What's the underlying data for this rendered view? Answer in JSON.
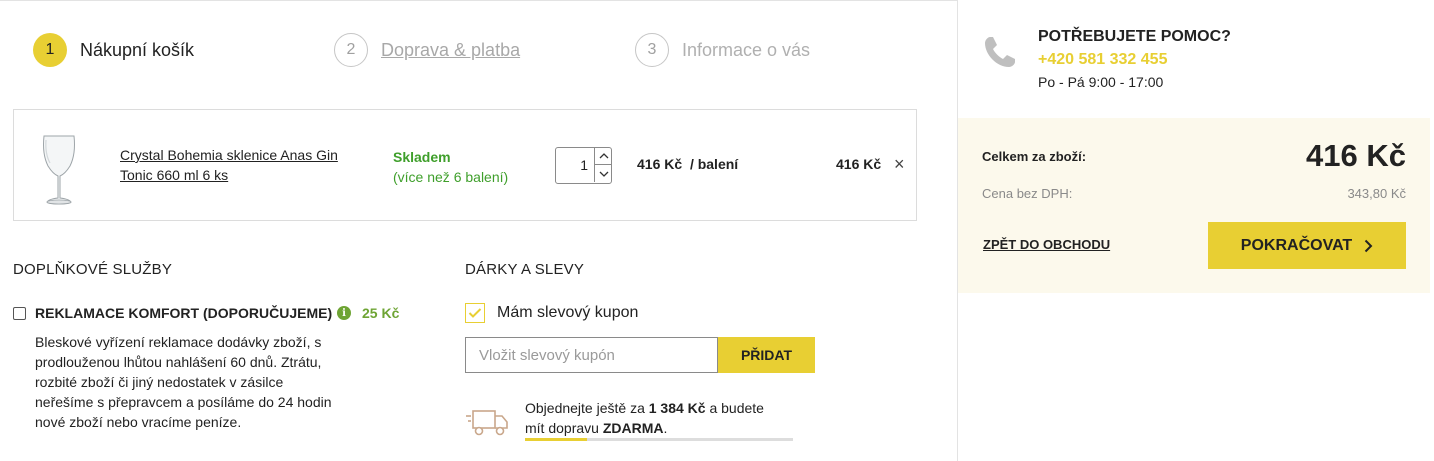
{
  "steps": [
    {
      "num": "1",
      "label": "Nákupní košík"
    },
    {
      "num": "2",
      "label": "Doprava & platba"
    },
    {
      "num": "3",
      "label": "Informace o vás"
    }
  ],
  "cart": {
    "item": {
      "name": "Crystal Bohemia sklenice Anas Gin Tonic 660 ml 6 ks",
      "stock_status": "Skladem",
      "stock_detail": "(více než 6 balení)",
      "quantity": "1",
      "unit_price": "416 Kč",
      "unit_suffix": "/ balení",
      "line_total": "416 Kč",
      "remove_symbol": "×"
    }
  },
  "services": {
    "title": "DOPLŇKOVÉ SLUŽBY",
    "option": {
      "name": "REKLAMACE KOMFORT (DOPORUČUJEME)",
      "info_symbol": "i",
      "price": "25 Kč",
      "description": "Bleskové vyřízení reklamace dodávky zboží, s prodlouženou lhůtou nahlášení 60 dnů. Ztrátu, rozbité zboží či jiný nedostatek v zásilce neřešíme s přepravcem a posíláme do 24 hodin nové zboží nebo vracíme peníze."
    }
  },
  "gifts": {
    "title": "DÁRKY A SLEVY",
    "coupon_label": "Mám slevový kupon",
    "coupon_placeholder": "Vložit slevový kupón",
    "add_label": "PŘIDAT",
    "shipping_prefix": "Objednejte ještě za ",
    "shipping_amount": "1 384 Kč",
    "shipping_middle": " a budete",
    "shipping_line2_prefix": "mít dopravu ",
    "shipping_free": "ZDARMA",
    "shipping_end": ".",
    "shipping_progress": 0.23
  },
  "help": {
    "title": "POTŘEBUJETE POMOC?",
    "phone": "+420 581 332 455",
    "hours": "Po - Pá 9:00 - 17:00"
  },
  "summary": {
    "total_label": "Celkem za zboží:",
    "total_value": "416 Kč",
    "vat_label": "Cena bez DPH:",
    "vat_value": "343,80 Kč",
    "back_label": "ZPĚT DO OBCHODU",
    "continue_label": "POKRAČOVAT"
  },
  "colors": {
    "accent": "#e8cf33",
    "stock_green": "#3f9f2b",
    "price_green": "#6ea434",
    "summary_bg": "#fcf9ec"
  },
  "icons": {
    "phone": "phone-icon",
    "truck": "truck-icon",
    "info": "info-icon",
    "remove": "close-icon",
    "check": "checkmark-icon",
    "chevron": "chevron-right-icon"
  }
}
